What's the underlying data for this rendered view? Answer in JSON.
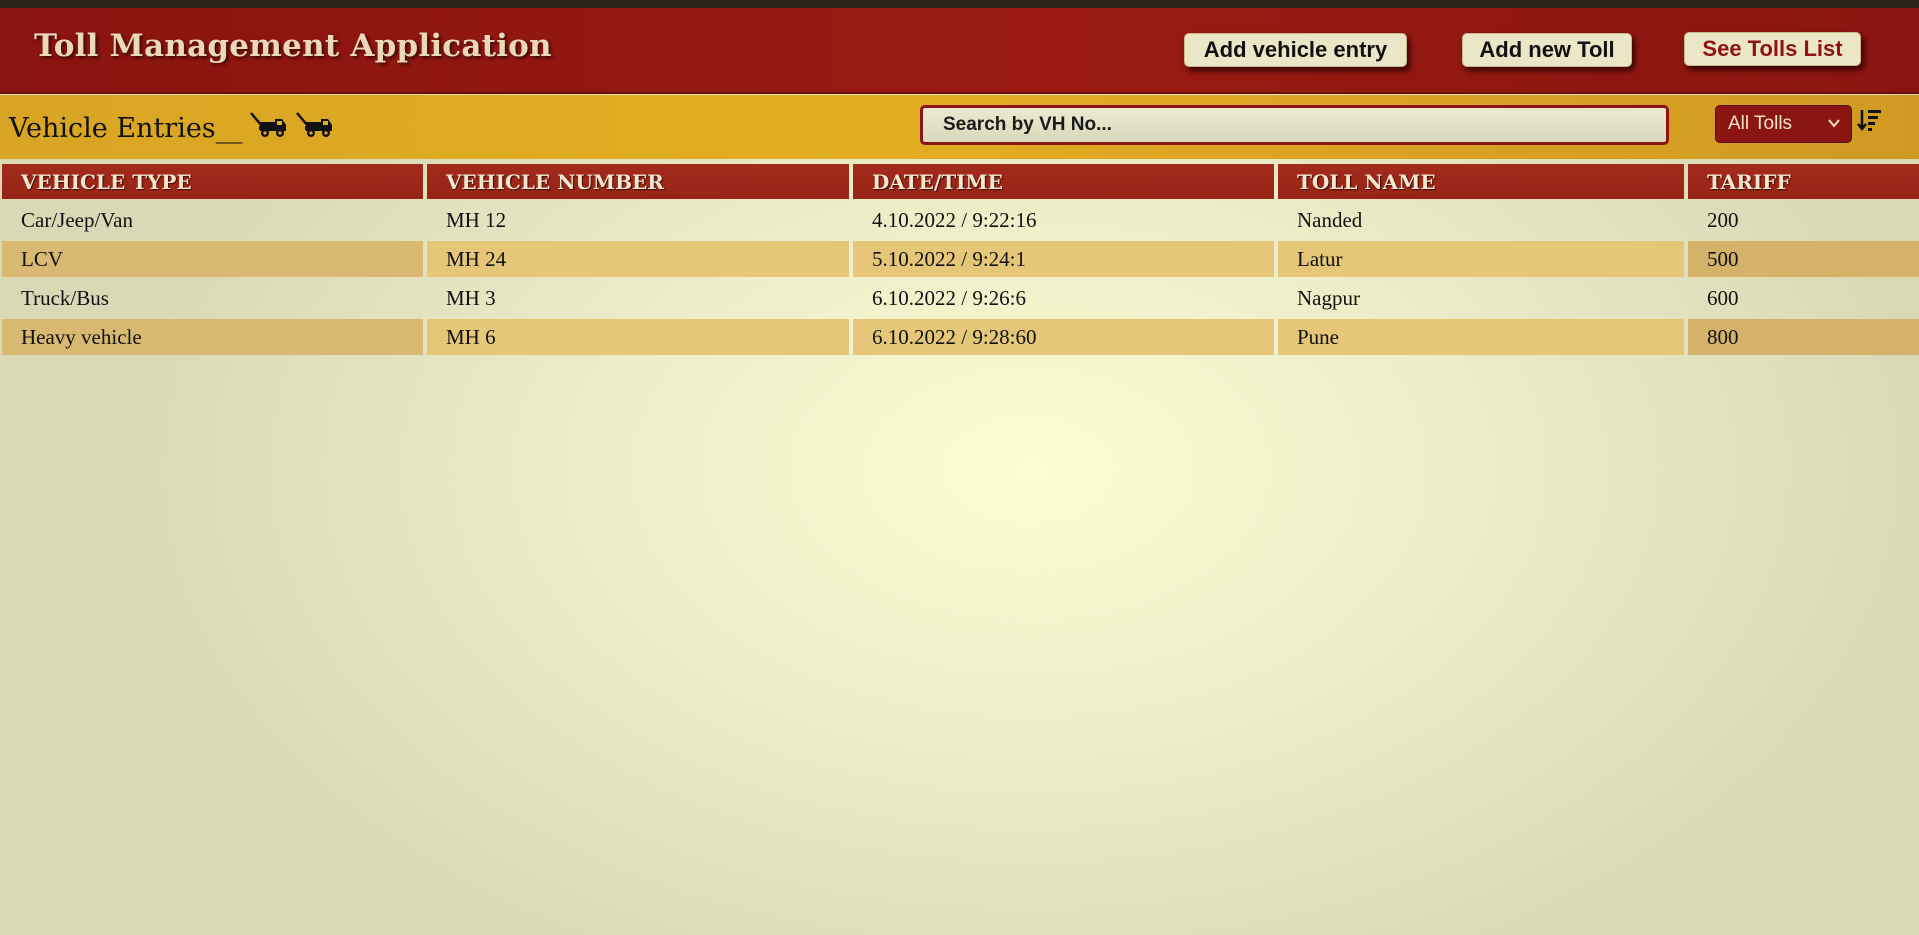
{
  "header": {
    "title": "Toll Management Application",
    "buttons": {
      "add_vehicle_entry": "Add vehicle entry",
      "add_new_toll": "Add new Toll",
      "see_tolls_list": "See Tolls List"
    }
  },
  "toolbar": {
    "section_title": "Vehicle Entries__",
    "icons": [
      "tow-truck-icon",
      "tow-truck-icon"
    ],
    "search": {
      "placeholder": "Search by VH No...",
      "value": ""
    },
    "toll_filter": {
      "selected": "All Tolls"
    },
    "sort_icon": "sort-descending-icon"
  },
  "table": {
    "columns": [
      "VEHICLE TYPE",
      "VEHICLE NUMBER",
      "DATE/TIME",
      "TOLL NAME",
      "TARIFF"
    ],
    "rows": [
      [
        "Car/Jeep/Van",
        "MH 12",
        "4.10.2022 / 9:22:16",
        "Nanded",
        "200"
      ],
      [
        "LCV",
        "MH 24",
        "5.10.2022 / 9:24:1",
        "Latur",
        "500"
      ],
      [
        "Truck/Bus",
        "MH 3",
        "6.10.2022 / 9:26:6",
        "Nagpur",
        "600"
      ],
      [
        "Heavy vehicle",
        "MH 6",
        "6.10.2022 / 9:28:60",
        "Pune",
        "800"
      ]
    ]
  },
  "colors": {
    "header_bg": "#9a1a12",
    "subbar_bg": "#e3ae21",
    "table_header_bg": "#a32b1b",
    "row_alt_bg": "#e6c77a",
    "accent_text": "#8f1310"
  }
}
